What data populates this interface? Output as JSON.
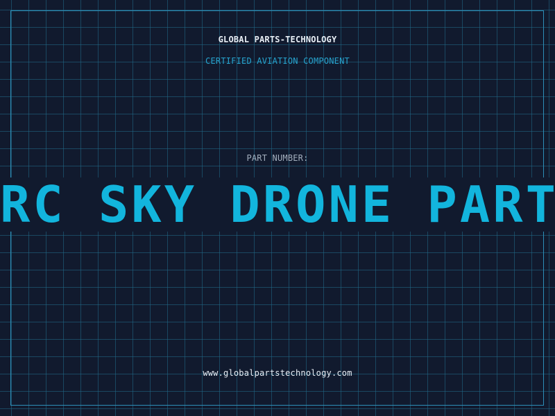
{
  "header": {
    "company": "GLOBAL PARTS-TECHNOLOGY",
    "tagline": "CERTIFIED AVIATION COMPONENT"
  },
  "part": {
    "label": "PART NUMBER:",
    "number": "RC SKY DRONE PARTS"
  },
  "footer": {
    "website": "www.globalpartstechnology.com"
  },
  "colors": {
    "background": "#111a2e",
    "grid": "#206c8a",
    "accent": "#12b5dd",
    "text": "#e8eef5"
  }
}
